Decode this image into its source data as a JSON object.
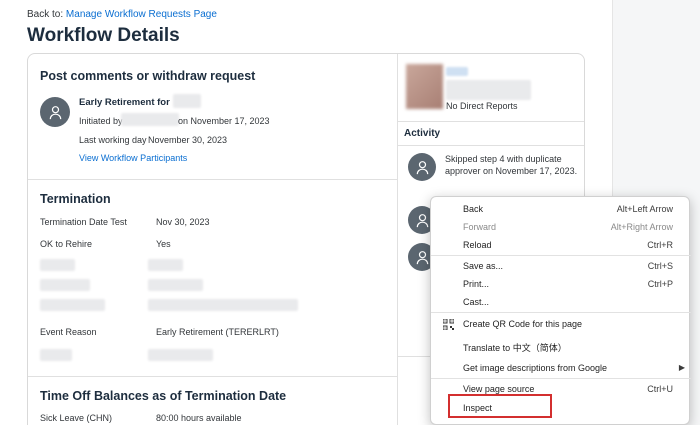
{
  "header": {
    "back_prefix": "Back to:",
    "back_link": "Manage Workflow Requests Page",
    "title": "Workflow Details"
  },
  "comments": {
    "heading": "Post comments or withdraw request",
    "request_title": "Early Retirement for",
    "initiated_by": "Initiated by",
    "initiated_on": "on November 17, 2023",
    "last_working_label": "Last working day",
    "last_working_value": "November 30, 2023",
    "participants_link": "View Workflow Participants"
  },
  "termination": {
    "heading": "Termination",
    "rows": [
      {
        "label": "Termination Date Test",
        "value": "Nov 30, 2023"
      },
      {
        "label": "OK to Rehire",
        "value": "Yes"
      }
    ],
    "event_reason_label": "Event Reason",
    "event_reason_value": "Early Retirement (TERERLRT)"
  },
  "time_off": {
    "heading": "Time Off Balances as of Termination Date",
    "rows": [
      {
        "label": "Sick Leave (CHN)",
        "value": "80:00 hours available"
      }
    ]
  },
  "profile": {
    "direct_reports": "No Direct Reports"
  },
  "activity": {
    "heading": "Activity",
    "items": [
      {
        "line1": "Skipped step 4 with duplicate",
        "line2": "approver on November 17, 2023."
      }
    ]
  },
  "context_menu": {
    "items": [
      {
        "label": "Back",
        "shortcut": "Alt+Left Arrow",
        "disabled": false
      },
      {
        "label": "Forward",
        "shortcut": "Alt+Right Arrow",
        "disabled": true
      },
      {
        "label": "Reload",
        "shortcut": "Ctrl+R",
        "disabled": false
      },
      {
        "label": "Save as...",
        "shortcut": "Ctrl+S",
        "disabled": false
      },
      {
        "label": "Print...",
        "shortcut": "Ctrl+P",
        "disabled": false
      },
      {
        "label": "Cast...",
        "shortcut": "",
        "disabled": false
      },
      {
        "label": "Create QR Code for this page",
        "shortcut": "",
        "disabled": false
      },
      {
        "label": "Translate to 中文（简体）",
        "shortcut": "",
        "disabled": false
      },
      {
        "label": "Get image descriptions from Google",
        "shortcut": "",
        "disabled": false
      },
      {
        "label": "View page source",
        "shortcut": "Ctrl+U",
        "disabled": false
      },
      {
        "label": "Inspect",
        "shortcut": "",
        "disabled": false
      }
    ]
  },
  "colors": {
    "link": "#0a6ed1",
    "avatar": "#5b6670",
    "highlight_box": "#d32f2f"
  }
}
